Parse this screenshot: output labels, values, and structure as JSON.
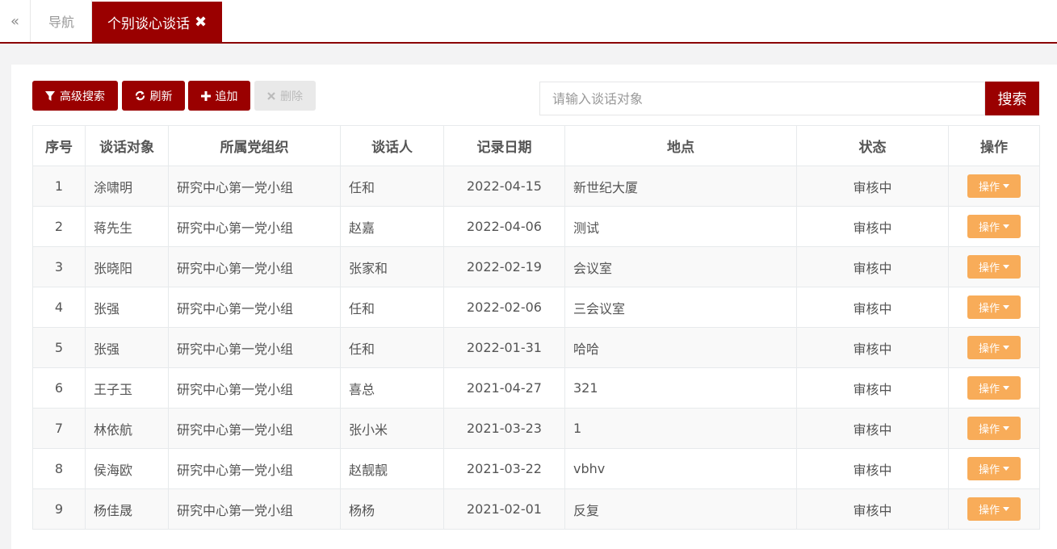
{
  "tabs": {
    "collapse": "«",
    "nav": "导航",
    "active": "个别谈心谈话",
    "close": "✖"
  },
  "toolbar": {
    "advanced_search": "高级搜索",
    "refresh": "刷新",
    "add": "追加",
    "delete": "删除",
    "icons": {
      "advanced_search": "filter-icon",
      "refresh": "refresh-icon",
      "add": "plus-icon",
      "delete": "close-icon"
    }
  },
  "search": {
    "placeholder": "请输入谈话对象",
    "button": "搜索"
  },
  "table": {
    "headers": [
      "序号",
      "谈话对象",
      "所属党组织",
      "谈话人",
      "记录日期",
      "地点",
      "状态",
      "操作"
    ],
    "op_label": "操作",
    "rows": [
      {
        "no": "1",
        "target": "涂啸明",
        "org": "研究中心第一党小组",
        "talker": "任和",
        "date": "2022-04-15",
        "place": "新世纪大厦",
        "status": "审核中"
      },
      {
        "no": "2",
        "target": "蒋先生",
        "org": "研究中心第一党小组",
        "talker": "赵嘉",
        "date": "2022-04-06",
        "place": "测试",
        "status": "审核中"
      },
      {
        "no": "3",
        "target": "张晓阳",
        "org": "研究中心第一党小组",
        "talker": "张家和",
        "date": "2022-02-19",
        "place": "会议室",
        "status": "审核中"
      },
      {
        "no": "4",
        "target": "张强",
        "org": "研究中心第一党小组",
        "talker": "任和",
        "date": "2022-02-06",
        "place": "三会议室",
        "status": "审核中"
      },
      {
        "no": "5",
        "target": "张强",
        "org": "研究中心第一党小组",
        "talker": "任和",
        "date": "2022-01-31",
        "place": "哈哈",
        "status": "审核中"
      },
      {
        "no": "6",
        "target": "王子玉",
        "org": "研究中心第一党小组",
        "talker": "喜总",
        "date": "2021-04-27",
        "place": "321",
        "status": "审核中"
      },
      {
        "no": "7",
        "target": "林依航",
        "org": "研究中心第一党小组",
        "talker": "张小米",
        "date": "2021-03-23",
        "place": "1",
        "status": "审核中"
      },
      {
        "no": "8",
        "target": "侯海欧",
        "org": "研究中心第一党小组",
        "talker": "赵靓靓",
        "date": "2021-03-22",
        "place": "vbhv",
        "status": "审核中"
      },
      {
        "no": "9",
        "target": "杨佳晟",
        "org": "研究中心第一党小组",
        "talker": "杨杨",
        "date": "2021-02-01",
        "place": "反复",
        "status": "审核中"
      }
    ]
  },
  "colors": {
    "brand": "#9a0000",
    "op_button": "#f8ac59"
  }
}
